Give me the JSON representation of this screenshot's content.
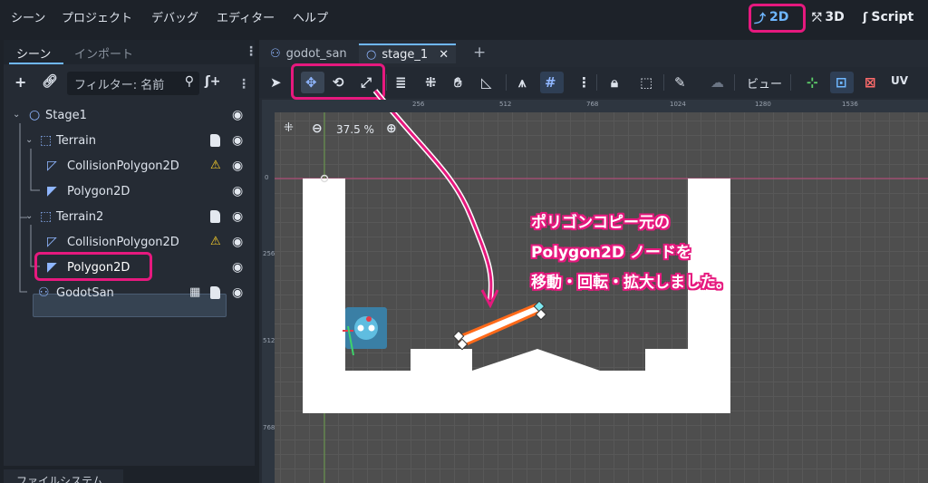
{
  "menu": {
    "items": [
      "シーン",
      "プロジェクト",
      "デバッグ",
      "エディター",
      "ヘルプ"
    ],
    "workspaces": [
      "2D",
      "3D",
      "Script"
    ],
    "active_workspace": "2D"
  },
  "left_dock": {
    "tabs": [
      "シーン",
      "インポート"
    ],
    "filter_placeholder": "フィルター: 名前",
    "tree": [
      {
        "name": "Stage1",
        "icon": "node2d-circle-icon",
        "depth": 0
      },
      {
        "name": "Terrain",
        "icon": "staticbody-icon",
        "depth": 1
      },
      {
        "name": "CollisionPolygon2D",
        "icon": "collision-polygon-icon",
        "depth": 2,
        "warning": true
      },
      {
        "name": "Polygon2D",
        "icon": "polygon2d-icon",
        "depth": 2
      },
      {
        "name": "Terrain2",
        "icon": "staticbody-icon",
        "depth": 1
      },
      {
        "name": "CollisionPolygon2D",
        "icon": "collision-polygon-icon",
        "depth": 2,
        "warning": true
      },
      {
        "name": "Polygon2D",
        "icon": "polygon2d-icon",
        "depth": 2,
        "selected": true
      },
      {
        "name": "GodotSan",
        "icon": "character-icon",
        "depth": 1
      }
    ],
    "bottom_tab": "ファイルシステム"
  },
  "editor": {
    "scene_tabs": [
      "godot_san",
      "stage_1"
    ],
    "active_scene_tab": "stage_1",
    "view_menu_label": "ビュー",
    "uv_label": "UV",
    "zoom_label": "37.5 %",
    "ruler_h": [
      "256",
      "512",
      "768",
      "1024",
      "1280",
      "1536"
    ],
    "ruler_v": [
      "0",
      "256",
      "512",
      "768"
    ]
  },
  "annotation": {
    "lines": [
      "ポリゴンコピー元の",
      "Polygon2D ノードを",
      "移動・回転・拡大しました。"
    ]
  },
  "colors": {
    "accent": "#6fb7ff",
    "highlight": "#e6197e",
    "warning": "#ffd32a"
  }
}
